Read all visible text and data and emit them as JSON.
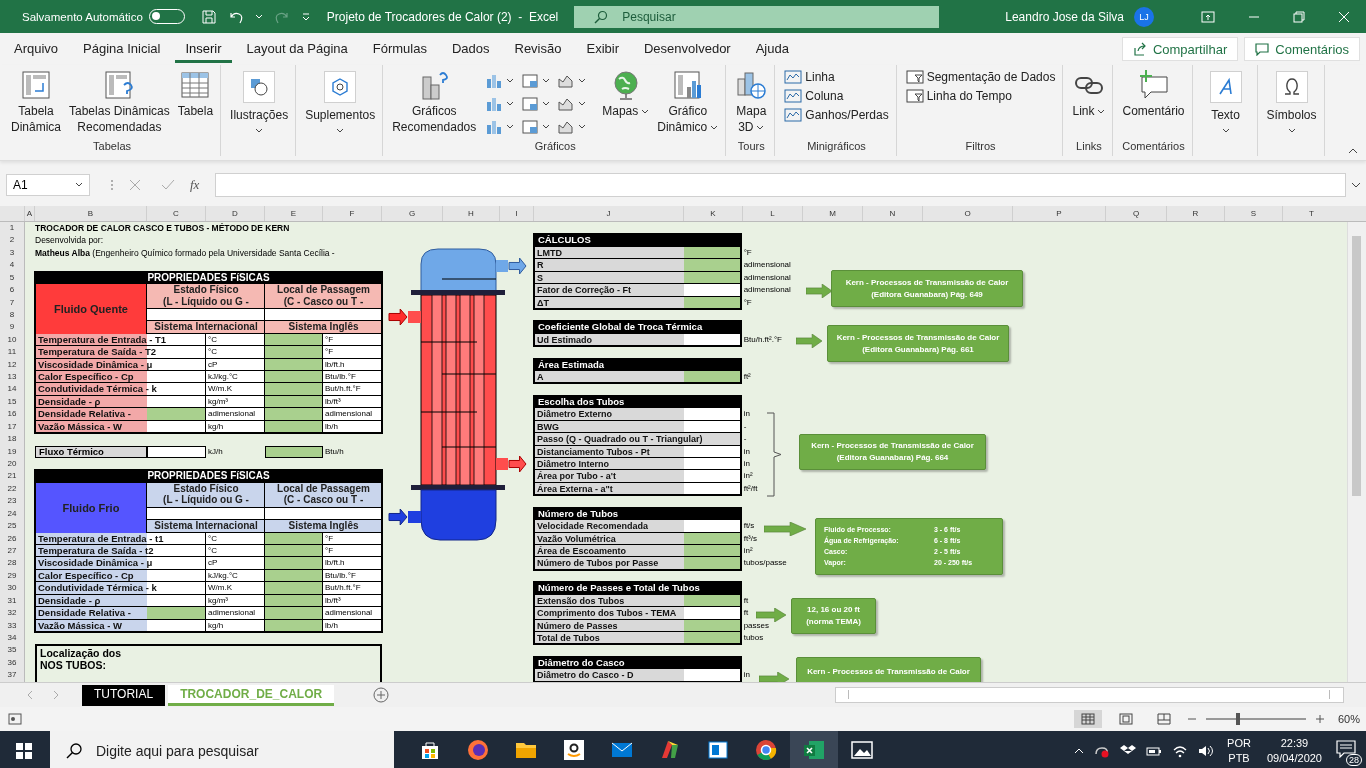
{
  "title_bar": {
    "autosave_label": "Salvamento Automático",
    "autosave_on": false,
    "document_title": "Projeto de Trocadores de Calor (2)  -  Excel",
    "search_placeholder": "Pesquisar",
    "user_name": "Leandro Jose da Silva",
    "user_initials": "LJ"
  },
  "menu_tabs": [
    {
      "label": "Arquivo",
      "selected": false
    },
    {
      "label": "Página Inicial",
      "selected": false
    },
    {
      "label": "Inserir",
      "selected": true
    },
    {
      "label": "Layout da Página",
      "selected": false
    },
    {
      "label": "Fórmulas",
      "selected": false
    },
    {
      "label": "Dados",
      "selected": false
    },
    {
      "label": "Revisão",
      "selected": false
    },
    {
      "label": "Exibir",
      "selected": false
    },
    {
      "label": "Desenvolvedor",
      "selected": false
    },
    {
      "label": "Ajuda",
      "selected": false
    }
  ],
  "share_button": "Compartilhar",
  "comments_button": "Comentários",
  "ribbon": {
    "groups": [
      {
        "label": "Tabelas",
        "kind": "large",
        "items": [
          {
            "label": "Tabela\nDinâmica",
            "dropdown": false
          },
          {
            "label": "Tabelas Dinâmicas\nRecomendadas",
            "dropdown": false
          },
          {
            "label": "Tabela",
            "dropdown": false
          }
        ]
      },
      {
        "kind": "framed",
        "items": [
          {
            "label": "Ilustrações",
            "dropdown": true
          }
        ]
      },
      {
        "kind": "framed",
        "items": [
          {
            "label": "Suplementos",
            "dropdown": true
          }
        ]
      },
      {
        "label": "Gráficos",
        "kind": "charts",
        "items": [
          {
            "label": "Gráficos\nRecomendados",
            "dropdown": false
          },
          {
            "label": "Mapas",
            "dropdown": true
          },
          {
            "label": "Gráfico\nDinâmico",
            "dropdown": true
          }
        ]
      },
      {
        "label": "Tours",
        "kind": "large",
        "items": [
          {
            "label": "Mapa\n3D",
            "dropdown": true
          }
        ]
      },
      {
        "label": "Minigráficos",
        "kind": "small",
        "items": [
          {
            "label": "Linha",
            "dropdown": false
          },
          {
            "label": "Coluna",
            "dropdown": false
          },
          {
            "label": "Ganhos/Perdas",
            "dropdown": false
          }
        ]
      },
      {
        "label": "Filtros",
        "kind": "small",
        "items": [
          {
            "label": "Segmentação de Dados",
            "dropdown": false
          },
          {
            "label": "Linha do Tempo",
            "dropdown": false
          }
        ]
      },
      {
        "label": "Links",
        "kind": "large",
        "items": [
          {
            "label": "Link",
            "dropdown": true
          }
        ]
      },
      {
        "label": "Comentários",
        "kind": "large",
        "items": [
          {
            "label": "Comentário",
            "dropdown": false
          }
        ]
      },
      {
        "kind": "framed",
        "items": [
          {
            "label": "Texto",
            "dropdown": true
          }
        ]
      },
      {
        "kind": "framed",
        "items": [
          {
            "label": "Símbolos",
            "dropdown": true
          }
        ]
      }
    ]
  },
  "formula_bar": {
    "name_box": "A1",
    "function_label": "fx"
  },
  "column_headers": [
    "A",
    "B",
    "C",
    "D",
    "E",
    "F",
    "G",
    "H",
    "I",
    "J",
    "K",
    "L",
    "M",
    "N",
    "O",
    "P",
    "Q",
    "R",
    "S",
    "T"
  ],
  "row_numbers": [
    "1",
    "2",
    "3",
    "4",
    "5",
    "6",
    "7",
    "8",
    "9",
    "10",
    "11",
    "12",
    "13",
    "14",
    "15",
    "16",
    "17",
    "18",
    "19",
    "20",
    "21",
    "22",
    "23",
    "24",
    "25",
    "26",
    "27",
    "28",
    "29",
    "30",
    "31",
    "32",
    "33",
    "34",
    "35",
    "36",
    "37"
  ],
  "sheet": {
    "title": "TROCADOR DE CALOR CASCO E TUBOS - MÉTODO DE KERN",
    "developed_by": "Desenvolvida por:",
    "author_line": "**Matheus Alba** (Engenheiro Químico formado pela Universidade Santa Cecília -",
    "hot_table": {
      "kind": "hot",
      "header": "PROPRIEDADES FíSICAS",
      "fluid": "Fluido Quente",
      "state_header": "Estado Físico\n(L - Líquido ou G -",
      "passage_header": "Local de Passagem\n(C - Casco ou T -",
      "si_header": "Sistema Internacional",
      "en_header": "Sistema Inglês",
      "rows": [
        {
          "label": "Temperatura de Entrada - T1",
          "si_computed": false,
          "si_unit": "°C",
          "en_unit": "°F"
        },
        {
          "label": "Temperatura de Saída - T2",
          "si_computed": false,
          "si_unit": "°C",
          "en_unit": "°F"
        },
        {
          "label": "Viscosidade Dinâmica - μ",
          "si_computed": false,
          "si_unit": "cP",
          "en_unit": "lb/ft.h"
        },
        {
          "label": "Calor Específico - Cp",
          "si_computed": false,
          "si_unit": "kJ/kg.°C",
          "en_unit": "Btu/lb.°F"
        },
        {
          "label": "Condutividade Térmica - k",
          "si_computed": false,
          "si_unit": "W/m.K",
          "en_unit": "But/h.ft.°F"
        },
        {
          "label": "Densidade - ρ",
          "si_computed": false,
          "si_unit": "kg/m³",
          "en_unit": "lb/ft³"
        },
        {
          "label": "Densidade Relativa -",
          "si_computed": true,
          "si_unit": "adimensional",
          "en_unit": "adimensional"
        },
        {
          "label": "Vazão Mássica - W",
          "si_computed": false,
          "si_unit": "kg/h",
          "en_unit": "lb/h"
        }
      ]
    },
    "flux": {
      "label": "Fluxo Térmico",
      "si_unit": "kJ/h",
      "en_unit": "Btu/h"
    },
    "cold_table": {
      "kind": "cold",
      "header": "PROPRIEDADES FíSICAS",
      "fluid": "Fluido Frio",
      "state_header": "Estado Físico\n(L - Líquido ou G -",
      "passage_header": "Local de Passagem\n(C - Casco ou T -",
      "si_header": "Sistema Internacional",
      "en_header": "Sistema Inglês",
      "rows": [
        {
          "label": "Temperatura de Entrada - t1",
          "si_computed": false,
          "si_unit": "°C",
          "en_unit": "°F"
        },
        {
          "label": "Temperatura de Saída - t2",
          "si_computed": false,
          "si_unit": "°C",
          "en_unit": "°F"
        },
        {
          "label": "Viscosidade Dinâmica - μ",
          "si_computed": false,
          "si_unit": "cP",
          "en_unit": "lb/ft.h"
        },
        {
          "label": "Calor Específico - Cp",
          "si_computed": false,
          "si_unit": "kJ/kg.°C",
          "en_unit": "Btu/lb.°F"
        },
        {
          "label": "Condutividade Térmica - k",
          "si_computed": false,
          "si_unit": "W/m.K",
          "en_unit": "But/h.ft.°F"
        },
        {
          "label": "Densidade - ρ",
          "si_computed": false,
          "si_unit": "kg/m³",
          "en_unit": "lb/ft³"
        },
        {
          "label": "Densidade Relativa -",
          "si_computed": true,
          "si_unit": "adimensional",
          "en_unit": "adimensional"
        },
        {
          "label": "Vazão Mássica - W",
          "si_computed": false,
          "si_unit": "kg/h",
          "en_unit": "lb/h"
        }
      ]
    },
    "location": {
      "title": "Localização dos",
      "subtitle": "NOS TUBOS:"
    },
    "calc_sections": [
      {
        "title": "CÁLCULOS",
        "rows": [
          {
            "label": "LMTD",
            "value_cell": true,
            "computed": true,
            "unit": "°F"
          },
          {
            "label": "R",
            "value_cell": true,
            "computed": true,
            "unit": "adimensional"
          },
          {
            "label": "S",
            "value_cell": true,
            "computed": true,
            "unit": "adimensional"
          },
          {
            "label": "Fator de Correção - Ft",
            "value_cell": true,
            "computed": false,
            "unit": "adimensional"
          },
          {
            "label": "ΔT",
            "value_cell": true,
            "computed": true,
            "unit": "°F"
          }
        ]
      },
      {
        "title": "Coeficiente Global de Troca Térmica",
        "rows": [
          {
            "label": "Ud Estimado",
            "value_cell": true,
            "computed": false,
            "unit": "Btu/h.ft².°F"
          }
        ]
      },
      {
        "title": "Área Estimada",
        "rows": [
          {
            "label": "A",
            "value_cell": true,
            "computed": true,
            "unit": "ft²"
          }
        ]
      },
      {
        "title": "Escolha dos Tubos",
        "rows": [
          {
            "label": "Diâmetro Externo",
            "value_cell": true,
            "computed": false,
            "unit": "in"
          },
          {
            "label": "BWG",
            "value_cell": true,
            "computed": false,
            "unit": "-"
          },
          {
            "label": "Passo (Q - Quadrado ou T - Triangular)",
            "value_cell": false,
            "computed": false,
            "unit": "-"
          },
          {
            "label": "Distanciamento Tubos - Pt",
            "value_cell": true,
            "computed": false,
            "unit": "in"
          },
          {
            "label": "Diâmetro Interno",
            "value_cell": true,
            "computed": false,
            "unit": "in"
          },
          {
            "label": "Área por Tubo - a't",
            "value_cell": true,
            "computed": false,
            "unit": "in²"
          },
          {
            "label": "Área Externa - a\"t",
            "value_cell": true,
            "computed": false,
            "unit": "ft²/ft"
          }
        ]
      },
      {
        "title": "Número de Tubos",
        "rows": [
          {
            "label": "Velocidade Recomendada",
            "value_cell": true,
            "computed": false,
            "unit": "ft/s"
          },
          {
            "label": "Vazão Volumétrica",
            "value_cell": true,
            "computed": true,
            "unit": "ft³/s"
          },
          {
            "label": "Área de Escoamento",
            "value_cell": true,
            "computed": true,
            "unit": "in²"
          },
          {
            "label": "Número de Tubos por Passe",
            "value_cell": true,
            "computed": true,
            "unit": "tubos/passe"
          }
        ]
      },
      {
        "title": "Número de Passes e Total de Tubos",
        "rows": [
          {
            "label": "Extensão dos Tubos",
            "value_cell": true,
            "computed": true,
            "unit": "ft"
          },
          {
            "label": "Comprimento dos Tubos - TEMA",
            "value_cell": true,
            "computed": false,
            "unit": "ft"
          },
          {
            "label": "Número de Passes",
            "value_cell": true,
            "computed": true,
            "unit": "passes"
          },
          {
            "label": "Total de Tubos",
            "value_cell": true,
            "computed": true,
            "unit": "tubos"
          }
        ]
      },
      {
        "title": "Diâmetro do Casco",
        "rows": [
          {
            "label": "Diâmetro do Casco - D",
            "value_cell": true,
            "computed": false,
            "unit": "in"
          }
        ]
      }
    ],
    "callouts": [
      {
        "bracket": false,
        "kind": "note",
        "lines": [
          "Kern - Processos de Transmissão de Calor",
          "(Editora Guanabara) Pág. 649"
        ]
      },
      {
        "bracket": false,
        "kind": "note",
        "lines": [
          "Kern - Processos de Transmissão de Calor",
          "(Editora Guanabara) Pág. 661"
        ]
      },
      {
        "bracket": true,
        "kind": "note",
        "lines": [
          "Kern - Processos de Transmissão de Calor",
          "(Editora Guanabara) Pág. 664"
        ]
      },
      {
        "bracket": false,
        "kind": "table",
        "rows": [
          {
            "name": "Fluido de Processo:",
            "value": "3 - 6 ft/s"
          },
          {
            "name": "Água de Refrigeração:",
            "value": "6 - 8 ft/s"
          },
          {
            "name": "Casco:",
            "value": "2 - 5 ft/s"
          },
          {
            "name": "Vapor:",
            "value": "20 - 250 ft/s"
          }
        ]
      },
      {
        "bracket": false,
        "kind": "note",
        "lines": [
          "12, 16 ou 20 ft",
          "(norma TEMA)"
        ]
      },
      {
        "bracket": false,
        "kind": "note",
        "lines": [
          "Kern - Processos de Transmissão de Calor"
        ]
      }
    ]
  },
  "sheet_tabs": [
    {
      "label": "TUTORIAL",
      "selected": false,
      "color": "#000000"
    },
    {
      "label": "TROCADOR_DE_CALOR",
      "selected": true,
      "color": "#70ad47"
    }
  ],
  "status_bar": {
    "zoom": {
      "level": 0.32,
      "reading": "60%"
    }
  },
  "taskbar": {
    "search_placeholder": "Digite aqui para pesquisar",
    "apps": [
      {
        "selected": false
      },
      {
        "selected": false
      },
      {
        "selected": false
      },
      {
        "selected": false
      },
      {
        "selected": false
      },
      {
        "selected": false
      },
      {
        "selected": false
      },
      {
        "selected": false
      },
      {
        "selected": true
      },
      {
        "selected": false
      }
    ],
    "language": "POR",
    "keyboard": "PTB",
    "time": "22:39",
    "date": "09/04/2020",
    "notifications": "28"
  }
}
